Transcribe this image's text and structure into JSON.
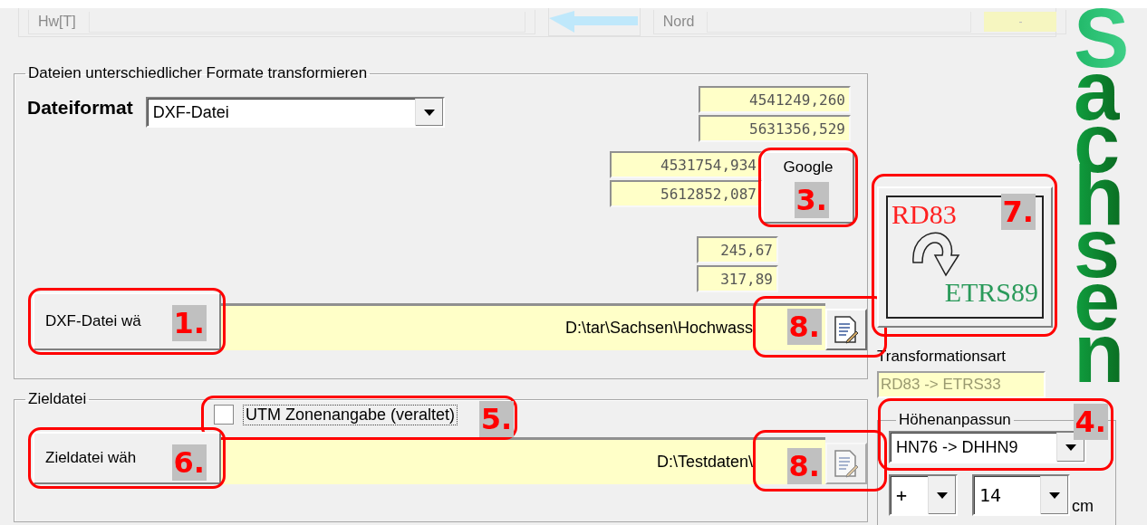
{
  "top_panel": {
    "label_1": "Hw[T]",
    "label_2": "Nord",
    "small_field": "-"
  },
  "format_group": {
    "title": "Dateien unterschiedlicher Formate transformieren",
    "format_label": "Dateiformat",
    "format_value": "DXF-Datei",
    "coordinates_1": [
      "4541249,260",
      "5631356,529"
    ],
    "coordinates_2": [
      "4531754,934",
      "5612852,087"
    ],
    "google_button": {
      "label": "Google",
      "callout": "3."
    },
    "values": [
      "245,67",
      "317,89"
    ],
    "select_button": {
      "label": "DXF-Datei wä",
      "callout": "1."
    },
    "path": "D:\\tar\\Sachsen\\Hochwass",
    "file_button": {
      "disabled": false,
      "callout": "8."
    }
  },
  "target_group": {
    "title": "Zieldatei",
    "utm_checkbox": {
      "label": "UTM Zonenangabe (veraltet)",
      "checked": false,
      "callout": "5."
    },
    "select_button": {
      "label": "Zieldatei wäh",
      "callout": "6."
    },
    "path": "D:\\Testdaten\\",
    "file_button": {
      "disabled": true,
      "callout": "8."
    }
  },
  "transformation_button": {
    "source": "RD83",
    "target": "ETRS89",
    "callout": "7."
  },
  "transformation_type": {
    "label": "Transformationsart",
    "value": "RD83 -> ETRS33",
    "disabled": true
  },
  "height_group": {
    "title": "Höhenanpassun",
    "callout": "4.",
    "mode": "HN76 -> DHHN9",
    "sign": "+",
    "value": "14",
    "unit": "cm"
  },
  "logo_text": "Sachsen"
}
